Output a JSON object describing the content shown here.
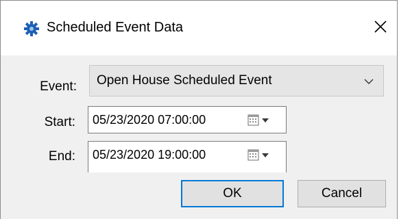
{
  "window": {
    "title": "Scheduled Event Data",
    "icon": "gear-icon"
  },
  "form": {
    "event_label": "Event:",
    "event_value": "Open House Scheduled Event",
    "start_label": "Start:",
    "start_value": "05/23/2020 07:00:00",
    "end_label": "End:",
    "end_value": "05/23/2020 19:00:00"
  },
  "buttons": {
    "ok_label": "OK",
    "cancel_label": "Cancel"
  },
  "colors": {
    "accent": "#0078d7",
    "icon_blue": "#1e5fb4",
    "dialog_bg": "#f0f0f0"
  }
}
